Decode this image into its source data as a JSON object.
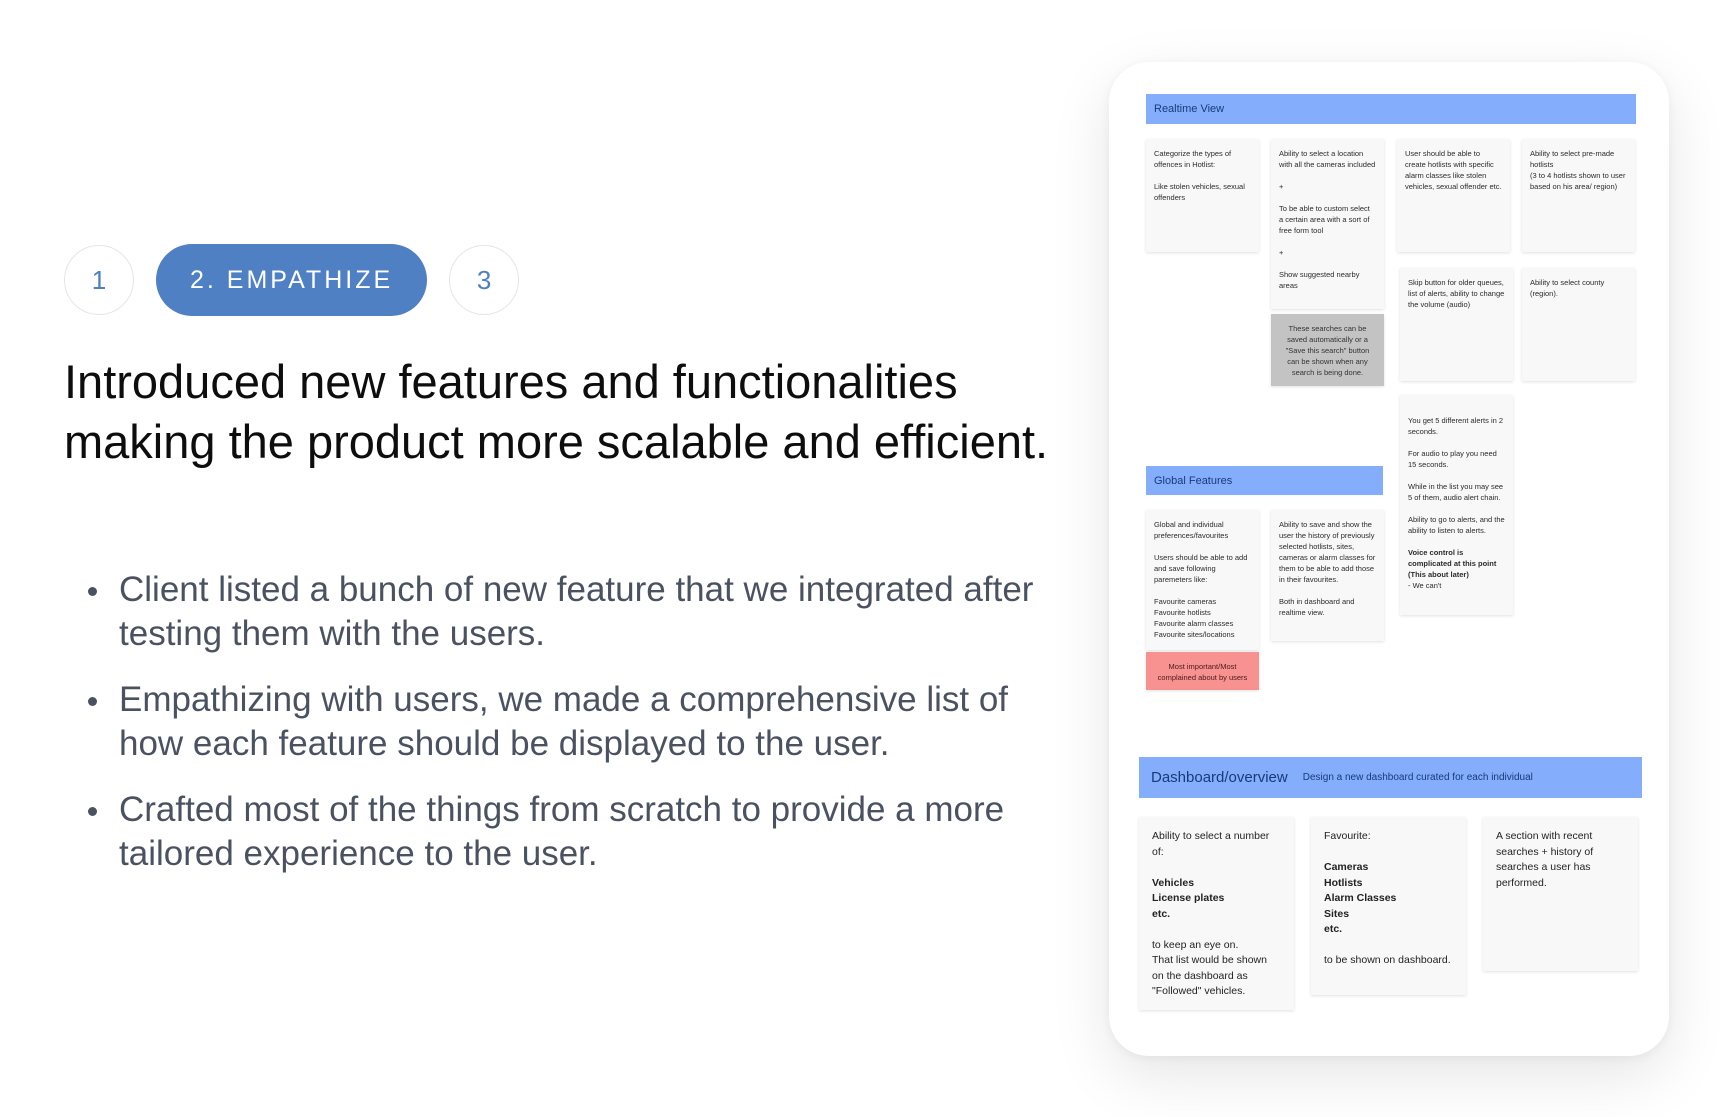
{
  "steps": {
    "prev": "1",
    "active": "2. EMPATHIZE",
    "next": "3"
  },
  "headline": "Introduced new features and functionalities making the product more scalable and efficient.",
  "bullets": [
    "Client listed a bunch of new feature that we integrated after testing them with the users.",
    "Empathizing with users, we made a comprehensive list of how each feature should be displayed to the user.",
    "Crafted most of the things from scratch to provide a more tailored experience to the user."
  ],
  "board": {
    "realtime": {
      "title": "Realtime View",
      "notes": [
        "Categorize the types of offences in Hotlist:\n\nLike stolen vehicles, sexual offenders",
        "Ability to select a location with all the cameras included\n\n+\n\nTo be able to custom select a certain area with a sort of free form tool\n\n+\n\nShow suggested nearby areas",
        "These searches can be saved automatically or a \"Save this search\" button can be shown when any search is being done.",
        "User should be able to create hotlists with specific alarm classes like stolen vehicles, sexual offender etc.",
        "Ability to select pre-made hotlists\n(3 to 4 hotlists shown to user based on his area/ region)",
        "Skip button for older queues, list of alerts, ability to change the volume (audio)",
        "Ability to select county (region).",
        "You get 5 different alerts in 2 seconds.\n\nFor audio to play you need 15 seconds.\n\nWhile in the list you may see 5 of them, audio alert chain.\n\nAbility to go to alerts, and the ability to listen to alerts."
      ],
      "voice_bold": "Voice control is complicated at this point (This about later)",
      "voice_rest": "- We can't"
    },
    "global": {
      "title": "Global Features",
      "notes": [
        "Global and individual preferences/favourites\n\nUsers should be able to add and save following paremeters like:\n\nFavourite cameras\nFavourite hotlists\nFavourite alarm classes\nFavourite sites/locations",
        "Most important/Most complained about by users",
        "Ability to save and show the user the history of previously selected hotlists, sites, cameras or alarm classes for them to be able to add those in their favourites.\n\nBoth in dashboard and realtime view."
      ]
    },
    "dashboard": {
      "title": "Dashboard/overview",
      "subtitle": "Design a new dashboard curated for each individual",
      "note1_intro": "Ability to select a number of:",
      "note1_bold": "Vehicles\nLicense plates\netc.",
      "note1_end": "to keep an eye on.\nThat list would be shown on the dashboard as \"Followed\" vehicles.",
      "note2_intro": "Favourite:",
      "note2_bold": "Cameras\nHotlists\nAlarm Classes\nSites\netc.",
      "note2_end": "to be shown on dashboard.",
      "note3": "A section with recent searches + history of searches a user has performed."
    }
  }
}
